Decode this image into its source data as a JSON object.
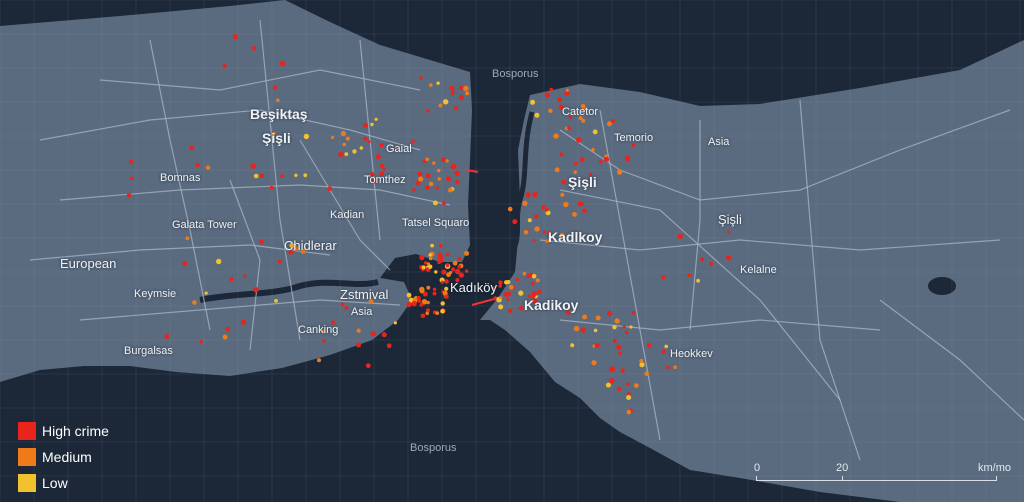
{
  "colors": {
    "water": "#1c2838",
    "land": "#5a6b80",
    "road": "#a9b6c6",
    "high": "#e8241c",
    "medium": "#ef7a1a",
    "low": "#f2c12e"
  },
  "water_labels": [
    {
      "id": "bosporus-north",
      "text": "Bosporus"
    },
    {
      "id": "bosporus-south",
      "text": "Bosporus"
    }
  ],
  "place_labels": [
    {
      "id": "besiktas",
      "text": "Beşiktaş"
    },
    {
      "id": "sisli-west",
      "text": "Şişli"
    },
    {
      "id": "bomnas",
      "text": "Bomnas"
    },
    {
      "id": "galata-tower",
      "text": "Galata Tower"
    },
    {
      "id": "european",
      "text": "European"
    },
    {
      "id": "keymsie",
      "text": "Keymsie"
    },
    {
      "id": "burgalsas",
      "text": "Burgalsas"
    },
    {
      "id": "gaial",
      "text": "Gaial"
    },
    {
      "id": "tomthez",
      "text": "Tomthez"
    },
    {
      "id": "kadian",
      "text": "Kadian"
    },
    {
      "id": "chidlerar",
      "text": "Chidlerar"
    },
    {
      "id": "tatsel-square",
      "text": "Tatsel Squaro"
    },
    {
      "id": "kadikoy-center",
      "text": "Kadıköy"
    },
    {
      "id": "zstmival",
      "text": "Zstmival"
    },
    {
      "id": "asia-small",
      "text": "Asia"
    },
    {
      "id": "canking",
      "text": "Canking"
    },
    {
      "id": "catetor",
      "text": "Catetor"
    },
    {
      "id": "temorio",
      "text": "Temorio"
    },
    {
      "id": "asia-east",
      "text": "Asia"
    },
    {
      "id": "sisli-east",
      "text": "Şişli"
    },
    {
      "id": "kadikoy-east",
      "text": "Kadlkoy"
    },
    {
      "id": "kadikoy-south",
      "text": "Kadikoy"
    },
    {
      "id": "kelalne",
      "text": "Kelalne"
    },
    {
      "id": "sisli-far",
      "text": "Şişli"
    },
    {
      "id": "heokkev",
      "text": "Heokkev"
    }
  ],
  "legend": [
    {
      "label": "High crime",
      "color": "#e8241c"
    },
    {
      "label": "Medium",
      "color": "#ef7a1a"
    },
    {
      "label": "Low",
      "color": "#f2c12e"
    }
  ],
  "scale_bar": {
    "ticks": [
      "0",
      "20"
    ],
    "unit": "km/mo"
  }
}
